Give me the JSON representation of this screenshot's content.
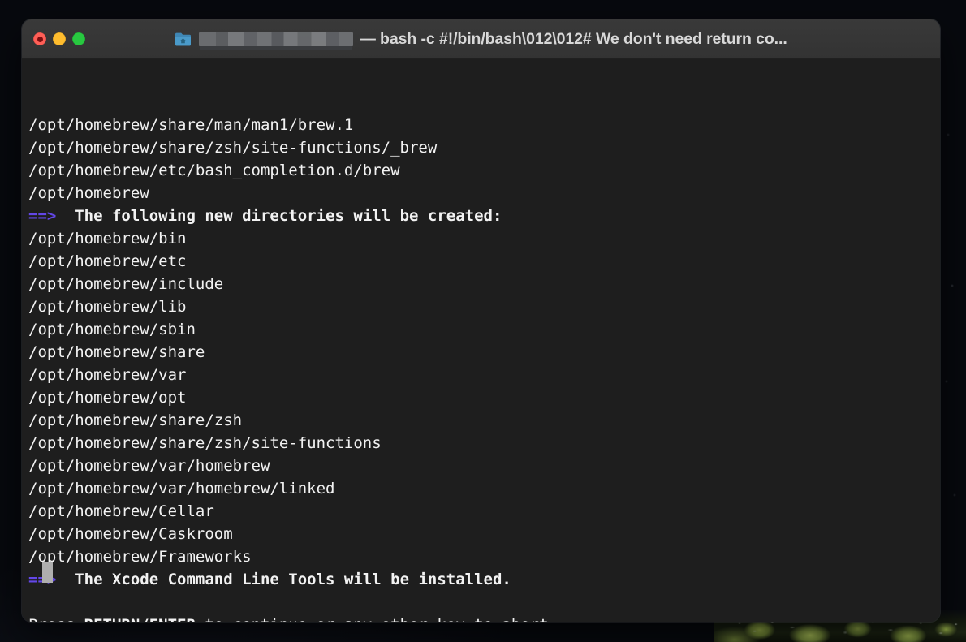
{
  "window": {
    "title": "— bash -c #!/bin/bash\\012\\012# We don't need return co...",
    "traffic_lights": [
      {
        "name": "close",
        "label": "Close",
        "color": "#ff5f57"
      },
      {
        "name": "minimize",
        "label": "Minimize",
        "color": "#febc2e"
      },
      {
        "name": "maximize",
        "label": "Maximize",
        "color": "#28c840"
      }
    ],
    "proxy_icon": "folder-home-icon",
    "redacted_path_label": "",
    "colors": {
      "titlebar_bg": "#333333",
      "titlebar_text": "#d8d8d8",
      "terminal_bg": "#1e1e1e",
      "terminal_text": "#f2f2f2",
      "accent_arrow": "#6347e8",
      "cursor": "#aeaeae",
      "desktop_bg": "#0a0c12"
    }
  },
  "terminal": {
    "lines": [
      {
        "type": "plain",
        "text": "/opt/homebrew/share/man/man1/brew.1"
      },
      {
        "type": "plain",
        "text": "/opt/homebrew/share/zsh/site-functions/_brew"
      },
      {
        "type": "plain",
        "text": "/opt/homebrew/etc/bash_completion.d/brew"
      },
      {
        "type": "plain",
        "text": "/opt/homebrew"
      },
      {
        "type": "notice",
        "marker": "==>",
        "text": "The following new directories will be created:"
      },
      {
        "type": "plain",
        "text": "/opt/homebrew/bin"
      },
      {
        "type": "plain",
        "text": "/opt/homebrew/etc"
      },
      {
        "type": "plain",
        "text": "/opt/homebrew/include"
      },
      {
        "type": "plain",
        "text": "/opt/homebrew/lib"
      },
      {
        "type": "plain",
        "text": "/opt/homebrew/sbin"
      },
      {
        "type": "plain",
        "text": "/opt/homebrew/share"
      },
      {
        "type": "plain",
        "text": "/opt/homebrew/var"
      },
      {
        "type": "plain",
        "text": "/opt/homebrew/opt"
      },
      {
        "type": "plain",
        "text": "/opt/homebrew/share/zsh"
      },
      {
        "type": "plain",
        "text": "/opt/homebrew/share/zsh/site-functions"
      },
      {
        "type": "plain",
        "text": "/opt/homebrew/var/homebrew"
      },
      {
        "type": "plain",
        "text": "/opt/homebrew/var/homebrew/linked"
      },
      {
        "type": "plain",
        "text": "/opt/homebrew/Cellar"
      },
      {
        "type": "plain",
        "text": "/opt/homebrew/Caskroom"
      },
      {
        "type": "plain",
        "text": "/opt/homebrew/Frameworks"
      },
      {
        "type": "notice",
        "marker": "==>",
        "text": "The Xcode Command Line Tools will be installed."
      },
      {
        "type": "blank",
        "text": ""
      },
      {
        "type": "prompt",
        "prefix": "Press ",
        "emphasis": "RETURN/ENTER",
        "suffix": " to continue or any other key to abort:"
      }
    ],
    "cursor_visible": true
  }
}
